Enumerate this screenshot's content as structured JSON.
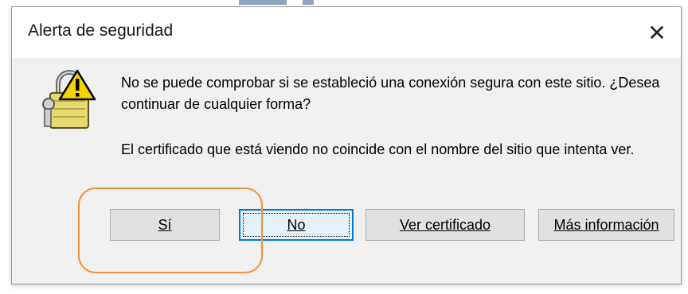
{
  "dialog": {
    "title": "Alerta de seguridad",
    "close_label": "✕",
    "message_1": "No se puede comprobar si se estableció una conexión segura con este sitio. ¿Desea continuar de cualquier forma?",
    "message_2": "El certificado que está viendo no coincide con el nombre del sitio que intenta ver.",
    "icon": "security-lock-warning-icon"
  },
  "buttons": {
    "yes": "Sí",
    "no": "No",
    "view_certificate": "Ver certificado",
    "more_info": "Más información"
  },
  "colors": {
    "accent_focus": "#0078d7",
    "highlight": "#f0913a",
    "dialog_bg": "#f0f0f0"
  }
}
